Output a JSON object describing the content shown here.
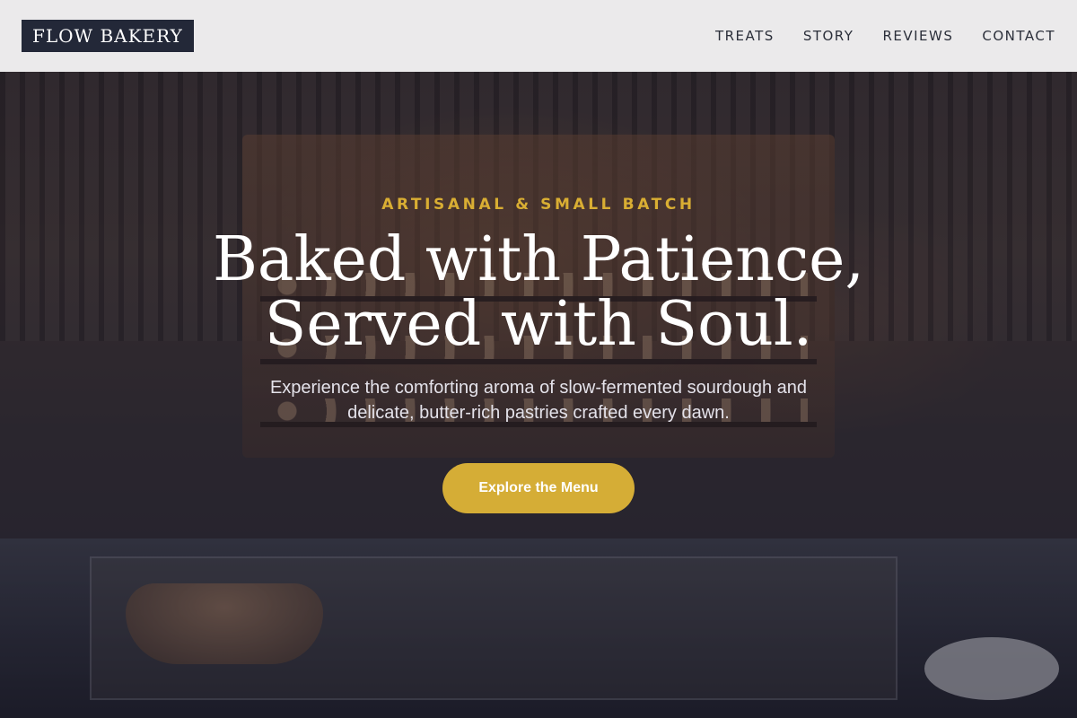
{
  "brand": {
    "logo_text": "FLOW BAKERY"
  },
  "nav": {
    "items": [
      {
        "label": "TREATS"
      },
      {
        "label": "STORY"
      },
      {
        "label": "REVIEWS"
      },
      {
        "label": "CONTACT"
      }
    ]
  },
  "hero": {
    "eyebrow": "ARTISANAL & SMALL BATCH",
    "headline_line1": "Baked with Patience,",
    "headline_line2": "Served with Soul.",
    "subtext": "Experience the comforting aroma of slow-fermented sourdough and delicate, butter-rich pastries crafted every dawn.",
    "cta_label": "Explore the Menu"
  },
  "colors": {
    "accent": "#d5ad36",
    "eyebrow": "#d9ae33",
    "logo_bg": "#232838",
    "nav_bg": "#fafafa",
    "nav_text": "#2b2f3a"
  }
}
